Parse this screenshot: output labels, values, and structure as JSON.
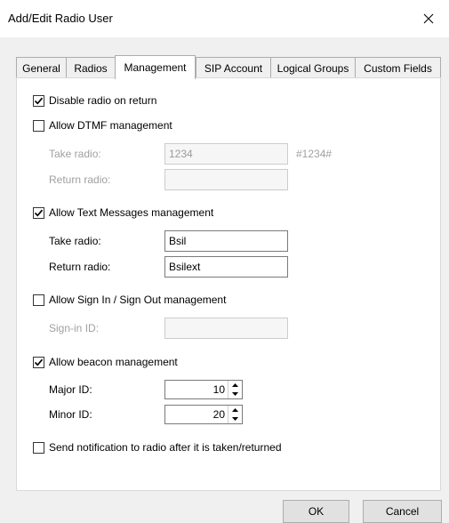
{
  "window": {
    "title": "Add/Edit Radio User",
    "close_label": "×"
  },
  "tabs": [
    {
      "label": "General"
    },
    {
      "label": "Radios"
    },
    {
      "label": "Management"
    },
    {
      "label": "SIP Account"
    },
    {
      "label": "Logical Groups"
    },
    {
      "label": "Custom Fields"
    }
  ],
  "active_tab": "Management",
  "management": {
    "disable_radio_on_return": {
      "label": "Disable radio on return",
      "checked": true
    },
    "dtmf": {
      "label": "Allow DTMF management",
      "checked": false,
      "take_label": "Take radio:",
      "take_value": "1234",
      "take_hint": "#1234#",
      "return_label": "Return radio:",
      "return_value": ""
    },
    "text_messages": {
      "label": "Allow Text Messages management",
      "checked": true,
      "take_label": "Take radio:",
      "take_value": "Bsil",
      "return_label": "Return radio:",
      "return_value": "Bsilext"
    },
    "sign_in": {
      "label": "Allow Sign In / Sign Out management",
      "checked": false,
      "signin_label": "Sign-in ID:",
      "signin_value": ""
    },
    "beacon": {
      "label": "Allow beacon management",
      "checked": true,
      "major_label": "Major ID:",
      "major_value": "10",
      "minor_label": "Minor ID:",
      "minor_value": "20"
    },
    "notification": {
      "label": "Send notification to radio after it is taken/returned",
      "checked": false
    }
  },
  "buttons": {
    "ok": "OK",
    "cancel": "Cancel"
  }
}
